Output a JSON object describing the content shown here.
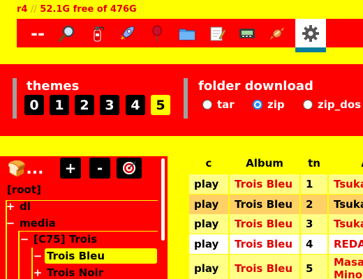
{
  "status": {
    "prefix": "r4",
    "sep": "//",
    "text": "52.1G free of 476G"
  },
  "toolbar": {
    "dash_label": "--",
    "buttons": [
      {
        "name": "search-icon"
      },
      {
        "name": "fire-extinguisher-icon"
      },
      {
        "name": "rocket-icon"
      },
      {
        "name": "balloon-icon"
      },
      {
        "name": "folder-icon"
      },
      {
        "name": "notepad-icon"
      },
      {
        "name": "pager-icon"
      },
      {
        "name": "candy-icon"
      },
      {
        "name": "gear-icon"
      }
    ],
    "active": "gear-icon"
  },
  "settings": {
    "themes_title": "themes",
    "themes": [
      "0",
      "1",
      "2",
      "3",
      "4",
      "5"
    ],
    "selected_theme": "5",
    "download_title": "folder download",
    "formats": [
      "tar",
      "zip",
      "zip_dos"
    ],
    "selected_format": "zip"
  },
  "tree": {
    "bread_icon": "🍞",
    "bread_dots": "...",
    "plus_label": "+",
    "minus_label": "-",
    "target_icon": "target-icon",
    "items": [
      {
        "toggle": "",
        "label": "[root]"
      },
      {
        "toggle": "+",
        "label": "dl"
      },
      {
        "toggle": "−",
        "label": "media"
      },
      {
        "toggle": "−",
        "label": "[C75] Trois"
      },
      {
        "toggle": "−",
        "label": "Trois Bleu"
      },
      {
        "toggle": "+",
        "label": "Trois Noir"
      }
    ]
  },
  "table": {
    "headers": [
      "c",
      "Album",
      "tn",
      "A"
    ],
    "rows": [
      {
        "c": "play",
        "album": "Trois Bleu",
        "tn": "1",
        "artist": "Tsuka"
      },
      {
        "c": "play",
        "album": "Trois Bleu",
        "tn": "2",
        "artist": "Tsuka"
      },
      {
        "c": "play",
        "album": "Trois Bleu",
        "tn": "3",
        "artist": "Tsuka"
      },
      {
        "c": "play",
        "album": "Trois Bleu",
        "tn": "4",
        "artist": "REDA"
      },
      {
        "c": "play",
        "album": "Trois Bleu",
        "tn": "5",
        "artist": "Masa Mino"
      }
    ]
  },
  "colors": {
    "background": "#ffff00",
    "panel": "#ff0000",
    "accent": "#0a7c9c",
    "link_red": "#e00000"
  }
}
